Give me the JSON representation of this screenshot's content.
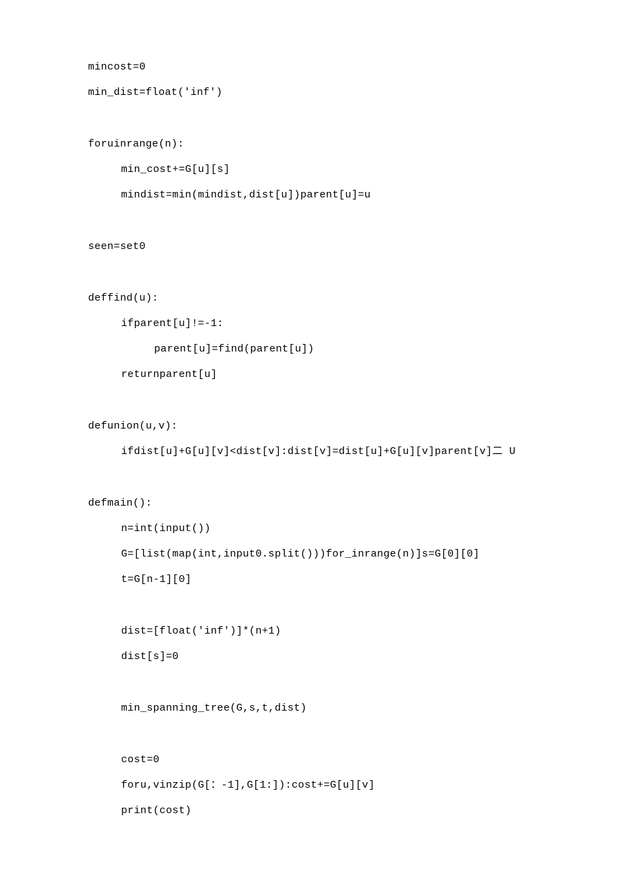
{
  "lines": {
    "l01": "mincost=0",
    "l02": "min_dist=float('inf')",
    "l03": "foruinrange(n):",
    "l04": "min_cost+=G[u][s]",
    "l05": "mindist=min(mindist,dist[u])parent[u]=u",
    "l06": "seen=set0",
    "l07": "deffind(u):",
    "l08": "ifparent[u]!=-1:",
    "l09": "parent[u]=find(parent[u])",
    "l10": "returnparent[u]",
    "l11": "defunion(u,v):",
    "l12": "ifdist[u]+G[u][v]<dist[v]:dist[v]=dist[u]+G[u][v]parent[v]二 U",
    "l13": "defmain():",
    "l14": "n=int(input())",
    "l15": "G=[list(map(int,input0.split()))for_inrange(n)]s=G[0][0]",
    "l16": "t=G[n-1][0]",
    "l17": "dist=[float('inf')]*(n+1)",
    "l18": "dist[s]=0",
    "l19": "min_spanning_tree(G,s,t,dist)",
    "l20": "cost=0",
    "l21": "foru,vinzip(G[：-1],G[1:]):cost+=G[u][v]",
    "l22": "print(cost)"
  }
}
